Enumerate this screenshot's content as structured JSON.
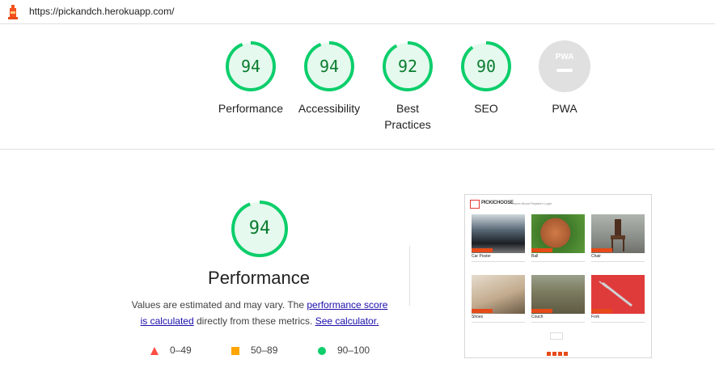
{
  "url": "https://pickandch.herokuapp.com/",
  "categories": [
    {
      "label": "Performance",
      "score": "94"
    },
    {
      "label": "Accessibility",
      "score": "94"
    },
    {
      "label": "Best",
      "label2": "Practices",
      "score": "92"
    },
    {
      "label": "SEO",
      "score": "90"
    },
    {
      "label": "PWA",
      "score": "PWA"
    }
  ],
  "performance": {
    "score": "94",
    "title": "Performance",
    "desc_prefix": "Values are estimated and may vary. The ",
    "link1_a": "performance score",
    "link1_b": "is calculated",
    "desc_mid": " directly from these metrics. ",
    "link2": "See calculator.",
    "legend": {
      "fail": "0–49",
      "average": "50–89",
      "pass": "90–100"
    }
  },
  "screenshot": {
    "logo": "PICKICHOOSE",
    "nav": "Home  About  Register  Login",
    "cards": [
      {
        "title": "Car Poster",
        "color": "#5a6a78"
      },
      {
        "title": "Ball",
        "color": "#b4653a"
      },
      {
        "title": "Chair",
        "color": "#8b8f8a"
      },
      {
        "title": "Shoes",
        "color": "#c2ab8e"
      },
      {
        "title": "Couch",
        "color": "#7b7a5e"
      },
      {
        "title": "Fork",
        "color": "#e03b3b"
      }
    ]
  },
  "colors": {
    "pass": "#0cce6b",
    "pass_text": "#0a7c2f",
    "pass_bg": "#e5f9ee",
    "average": "#ffa400",
    "fail": "#ff4e42"
  }
}
